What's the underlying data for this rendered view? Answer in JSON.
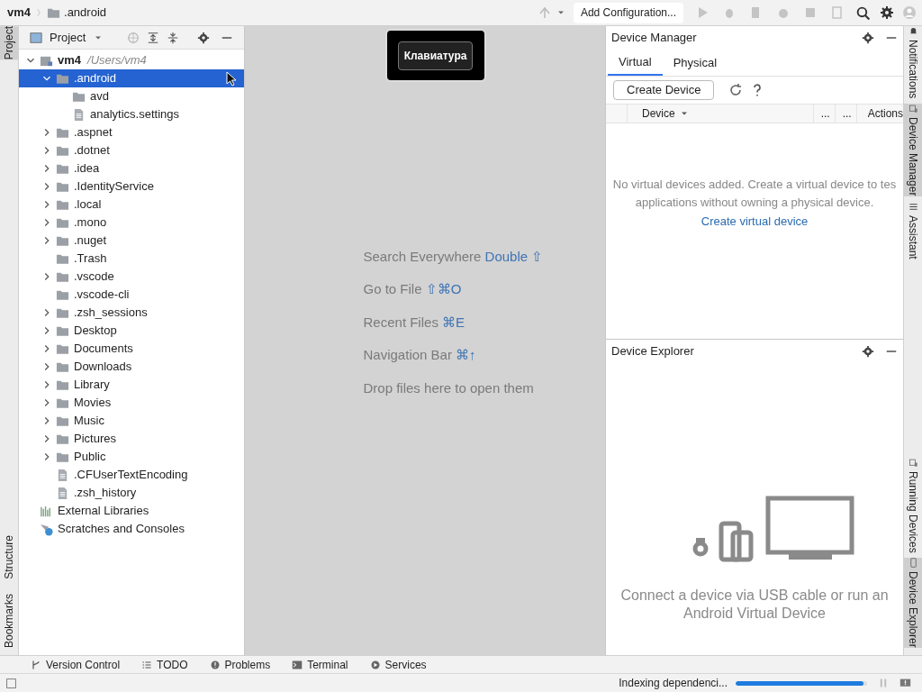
{
  "breadcrumbs": [
    {
      "label": "vm4",
      "kind": "project"
    },
    {
      "label": ".android",
      "kind": "folder"
    }
  ],
  "toolbar": {
    "run_config": "Add Configuration..."
  },
  "left_strip": {
    "top": [
      {
        "label": "Project",
        "selected": true
      }
    ],
    "bottom": [
      {
        "label": "Structure",
        "selected": false
      },
      {
        "label": "Bookmarks",
        "selected": false
      }
    ]
  },
  "project_panel": {
    "title": "Project",
    "tree": [
      {
        "label": "vm4",
        "path": "/Users/vm4",
        "kind": "module",
        "expanded": true,
        "selected": false,
        "children": [
          {
            "label": ".android",
            "kind": "folder",
            "expanded": true,
            "selected": true,
            "children": [
              {
                "label": "avd",
                "kind": "folder",
                "selected": false
              },
              {
                "label": "analytics.settings",
                "kind": "file",
                "selected": false
              }
            ]
          },
          {
            "label": ".aspnet",
            "kind": "folder",
            "expanded": false,
            "selected": false
          },
          {
            "label": ".dotnet",
            "kind": "folder",
            "expanded": false,
            "selected": false
          },
          {
            "label": ".idea",
            "kind": "folder",
            "expanded": false,
            "selected": false
          },
          {
            "label": ".IdentityService",
            "kind": "folder",
            "expanded": false,
            "selected": false
          },
          {
            "label": ".local",
            "kind": "folder",
            "expanded": false,
            "selected": false
          },
          {
            "label": ".mono",
            "kind": "folder",
            "expanded": false,
            "selected": false
          },
          {
            "label": ".nuget",
            "kind": "folder",
            "expanded": false,
            "selected": false
          },
          {
            "label": ".Trash",
            "kind": "folder",
            "selected": false
          },
          {
            "label": ".vscode",
            "kind": "folder",
            "expanded": false,
            "selected": false
          },
          {
            "label": ".vscode-cli",
            "kind": "folder",
            "selected": false
          },
          {
            "label": ".zsh_sessions",
            "kind": "folder",
            "expanded": false,
            "selected": false
          },
          {
            "label": "Desktop",
            "kind": "folder",
            "expanded": false,
            "selected": false
          },
          {
            "label": "Documents",
            "kind": "folder",
            "expanded": false,
            "selected": false
          },
          {
            "label": "Downloads",
            "kind": "folder",
            "expanded": false,
            "selected": false
          },
          {
            "label": "Library",
            "kind": "folder",
            "expanded": false,
            "selected": false
          },
          {
            "label": "Movies",
            "kind": "folder",
            "expanded": false,
            "selected": false
          },
          {
            "label": "Music",
            "kind": "folder",
            "expanded": false,
            "selected": false
          },
          {
            "label": "Pictures",
            "kind": "folder",
            "expanded": false,
            "selected": false
          },
          {
            "label": "Public",
            "kind": "folder",
            "expanded": false,
            "selected": false
          },
          {
            "label": ".CFUserTextEncoding",
            "kind": "file",
            "selected": false
          },
          {
            "label": ".zsh_history",
            "kind": "file",
            "selected": false
          }
        ]
      },
      {
        "label": "External Libraries",
        "kind": "libraries",
        "selected": false
      },
      {
        "label": "Scratches and Consoles",
        "kind": "scratches",
        "selected": false
      }
    ]
  },
  "tooltip": {
    "label": "Клавиатура"
  },
  "editor_hints": [
    {
      "text": "Search Everywhere",
      "shortcut": "Double ⇧"
    },
    {
      "text": "Go to File",
      "shortcut": "⇧⌘O"
    },
    {
      "text": "Recent Files",
      "shortcut": "⌘E"
    },
    {
      "text": "Navigation Bar",
      "shortcut": "⌘↑"
    },
    {
      "text": "Drop files here to open them"
    }
  ],
  "device_manager": {
    "title": "Device Manager",
    "tabs": [
      {
        "label": "Virtual",
        "selected": true
      },
      {
        "label": "Physical",
        "selected": false
      }
    ],
    "create_button": "Create Device",
    "columns": [
      "Device",
      "...",
      "...",
      "Actions"
    ],
    "empty_text": "No virtual devices added. Create a virtual device to tes",
    "empty_text_2": "applications without owning a physical device.",
    "link": "Create virtual device"
  },
  "device_explorer": {
    "title": "Device Explorer",
    "message": "Connect a device via USB cable or run an Android Virtual Device"
  },
  "right_strip": {
    "top": [
      {
        "label": "Notifications",
        "kind": "bell",
        "selected": false
      },
      {
        "label": "Device Manager",
        "kind": "device",
        "selected": true
      },
      {
        "label": "Assistant",
        "kind": "list",
        "selected": false
      }
    ],
    "bottom": [
      {
        "label": "Running Devices",
        "kind": "device",
        "selected": false
      },
      {
        "label": "Device Explorer",
        "kind": "phone",
        "selected": true
      }
    ]
  },
  "bottom_tools": [
    {
      "label": "Version Control",
      "kind": "branch"
    },
    {
      "label": "TODO",
      "kind": "list"
    },
    {
      "label": "Problems",
      "kind": "alert"
    },
    {
      "label": "Terminal",
      "kind": "terminal"
    },
    {
      "label": "Services",
      "kind": "services"
    }
  ],
  "status_bar": {
    "task": "Indexing dependenci...",
    "level": 0.97
  }
}
